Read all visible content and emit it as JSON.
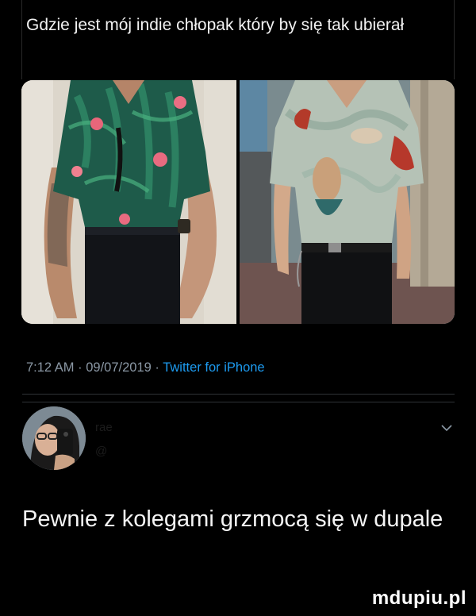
{
  "tweet": {
    "text": "Gdzie jest mój indie chłopak który by się tak ubierał",
    "time": "7:12 AM",
    "date": "09/07/2019",
    "source": "Twitter for iPhone",
    "separator": "·"
  },
  "reply": {
    "name": "rae",
    "handle": "@",
    "text": "Pewnie z kolegami grzmocą się w dupale",
    "menu_icon": "chevron-down-icon"
  },
  "watermark": {
    "text": "mdupiu.pl"
  },
  "colors": {
    "background": "#000000",
    "link": "#1d9bf0",
    "meta": "#8b98a5",
    "divider": "#2f3336"
  }
}
